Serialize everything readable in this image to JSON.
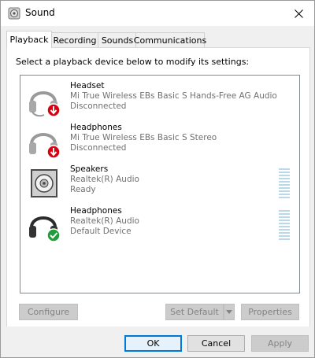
{
  "window": {
    "title": "Sound",
    "close_glyph": "✕"
  },
  "tabs": [
    {
      "label": "Playback",
      "active": true
    },
    {
      "label": "Recording",
      "active": false
    },
    {
      "label": "Sounds",
      "active": false
    },
    {
      "label": "Communications",
      "active": false
    }
  ],
  "panel": {
    "instruction": "Select a playback device below to modify its settings:"
  },
  "devices": [
    {
      "name": "Headset",
      "description": "Mi True Wireless EBs Basic S Hands-Free AG Audio",
      "status": "Disconnected",
      "icon": "headset-icon",
      "badge": "disconnected-badge"
    },
    {
      "name": "Headphones",
      "description": "Mi True Wireless EBs Basic S Stereo",
      "status": "Disconnected",
      "icon": "headphones-icon",
      "badge": "disconnected-badge"
    },
    {
      "name": "Speakers",
      "description": "Realtek(R) Audio",
      "status": "Ready",
      "icon": "speaker-icon",
      "badge": ""
    },
    {
      "name": "Headphones",
      "description": "Realtek(R) Audio",
      "status": "Default Device",
      "icon": "headphones-icon",
      "badge": "default-checkmark-badge"
    }
  ],
  "buttons": {
    "configure": "Configure",
    "set_default": "Set Default",
    "properties": "Properties",
    "ok": "OK",
    "cancel": "Cancel",
    "apply": "Apply"
  },
  "colors": {
    "disconnected_red": "#d9000f",
    "default_green": "#1f9e3a",
    "level_meter": "#b9d9e8",
    "focus_blue": "#0078d7"
  }
}
